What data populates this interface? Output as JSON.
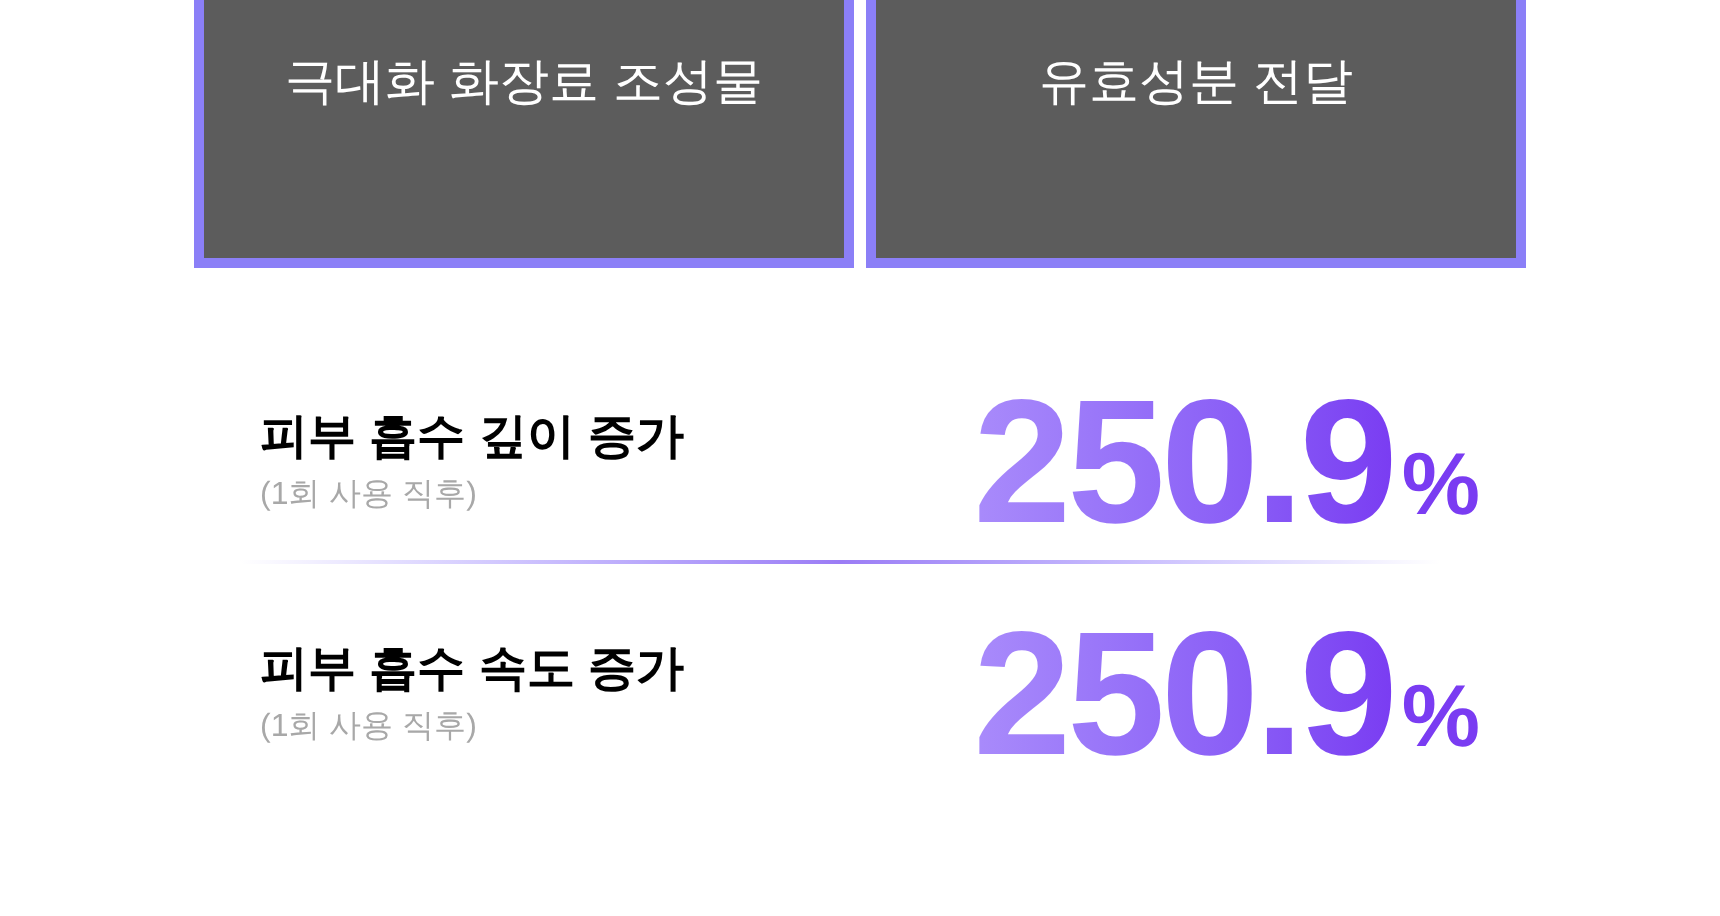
{
  "patents": [
    {
      "title": "극대화 화장료 조성물"
    },
    {
      "title": "유효성분 전달"
    }
  ],
  "stats": [
    {
      "label": "피부 흡수 깊이 증가",
      "note": "(1회 사용 직후)",
      "value": "250.9",
      "unit": "%"
    },
    {
      "label": "피부 흡수 속도 증가",
      "note": "(1회 사용 직후)",
      "value": "250.9",
      "unit": "%"
    }
  ]
}
